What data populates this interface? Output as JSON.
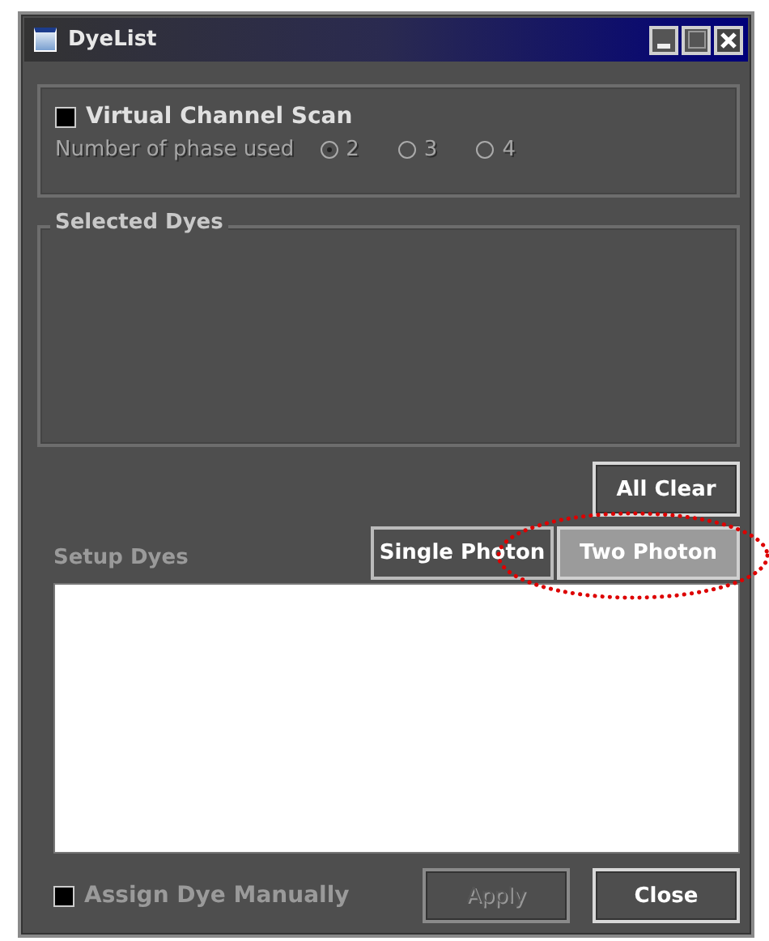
{
  "window": {
    "title": "DyeList"
  },
  "virtual_channel_scan": {
    "label": "Virtual Channel Scan",
    "checked": false
  },
  "phases": {
    "label": "Number of phase used",
    "disabled": true,
    "options": [
      {
        "label": "2",
        "selected": true
      },
      {
        "label": "3",
        "selected": false
      },
      {
        "label": "4",
        "selected": false
      }
    ]
  },
  "selected_dyes": {
    "title": "Selected Dyes"
  },
  "all_clear": {
    "label": "All Clear"
  },
  "setup_dyes": {
    "label": "Setup Dyes",
    "tabs": [
      {
        "label": "Single Photon",
        "selected": false
      },
      {
        "label": "Two Photon",
        "selected": true
      }
    ]
  },
  "assign_manually": {
    "label": "Assign Dye Manually",
    "checked": false
  },
  "buttons": [
    {
      "label": "Apply",
      "disabled": true
    },
    {
      "label": "Close",
      "disabled": false
    }
  ]
}
